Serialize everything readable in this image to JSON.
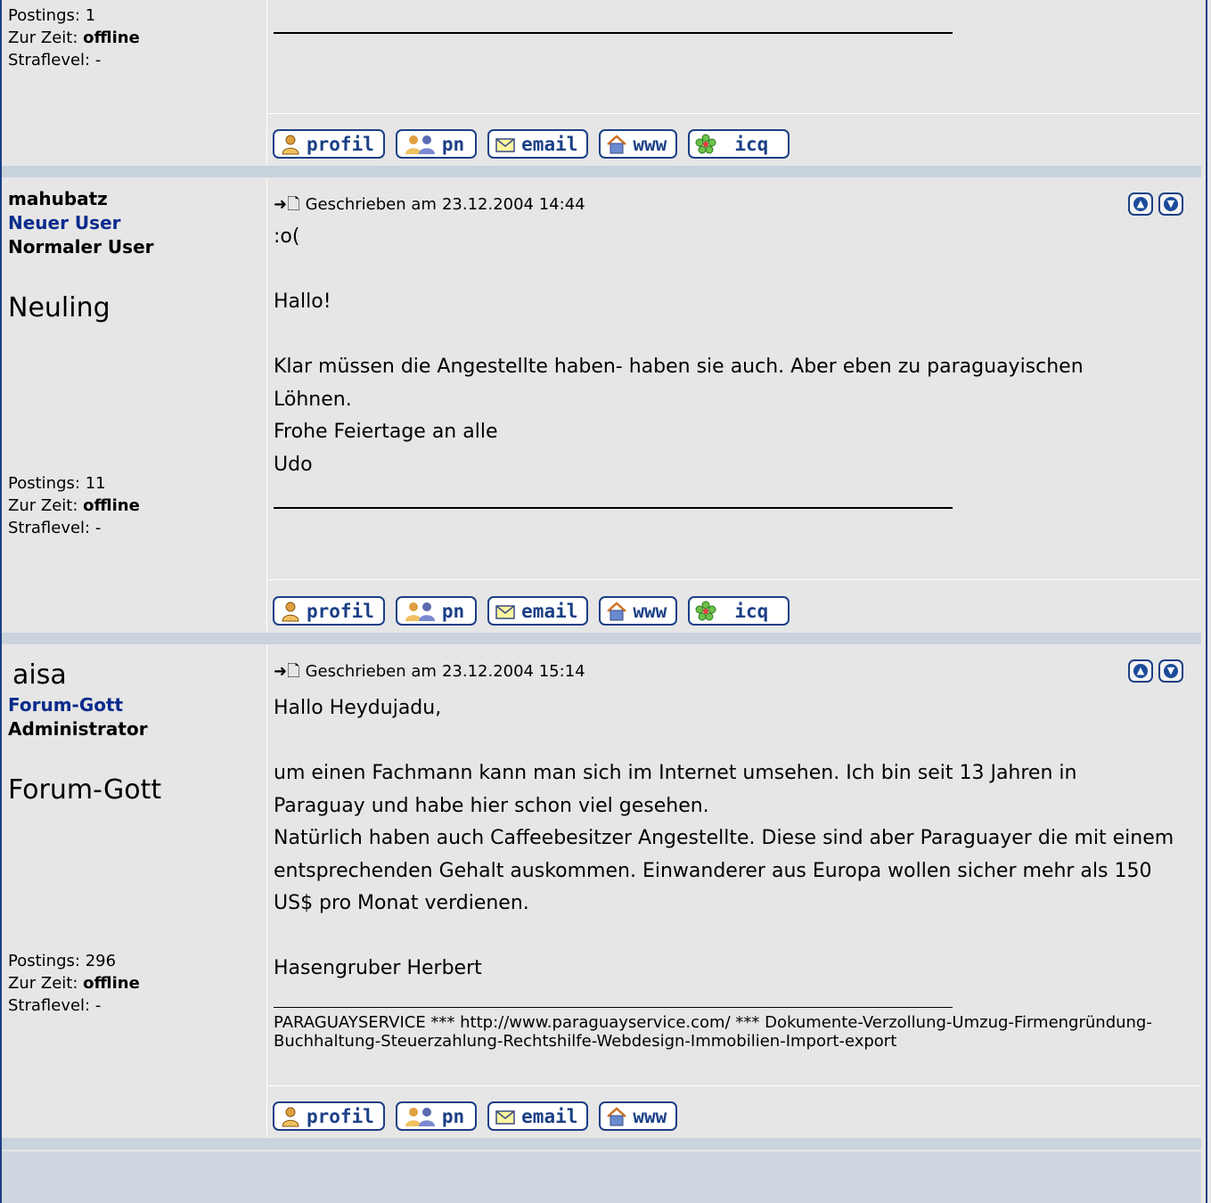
{
  "labels": {
    "postings_prefix": "Postings:",
    "status_prefix": "Zur Zeit:",
    "penalty_line": "Straflevel: -",
    "written_prefix": "Geschrieben am",
    "arrow": "➜🗋"
  },
  "buttons": {
    "profil": "profil",
    "pn": "pn",
    "email": "email",
    "www": "www",
    "icq": "icq"
  },
  "top_post": {
    "postings": "1",
    "status": "offline"
  },
  "post1": {
    "username": "mahubatz",
    "rank": "Neuer User",
    "role": "Normaler User",
    "title": "Neuling",
    "date": "23.12.2004 14:44",
    "postings": "11",
    "status": "offline",
    "lines": [
      ":o(",
      "",
      "Hallo!",
      "",
      "Klar müssen die Angestellte haben- haben sie auch. Aber eben zu paraguayischen Löhnen.",
      "Frohe Feiertage an alle",
      "Udo"
    ]
  },
  "post2": {
    "username": "aisa",
    "rank": "Forum-Gott",
    "role": "Administrator",
    "title": "Forum-Gott",
    "date": "23.12.2004 15:14",
    "postings": "296",
    "status": "offline",
    "lines": [
      "Hallo Heydujadu,",
      "",
      "um einen Fachmann kann man sich im Internet umsehen. Ich bin seit 13 Jahren in Paraguay und habe hier schon viel gesehen.",
      "Natürlich haben auch Caffeebesitzer Angestellte. Diese sind aber Paraguayer die mit einem entsprechenden Gehalt auskommen. Einwanderer aus Europa wollen sicher mehr als 150 US$ pro Monat verdienen.",
      "",
      "Hasengruber Herbert"
    ],
    "signature": "PARAGUAYSERVICE *** http://www.paraguayservice.com/ *** Dokumente-Verzollung-Umzug-Firmengründung-Buchhaltung-Steuerzahlung-Rechtshilfe-Webdesign-Immobilien-Import-export"
  },
  "colors": {
    "page_bg": "#e6e6e6",
    "separator": "#c9d3dd",
    "frame": "#1b3f86",
    "rank_blue": "#0b2b8c"
  }
}
